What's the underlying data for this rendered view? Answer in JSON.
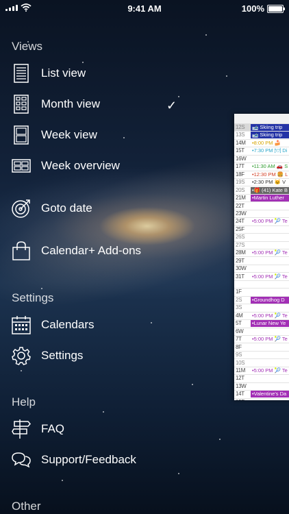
{
  "status_bar": {
    "time": "9:41 AM",
    "battery": "100%"
  },
  "sections": {
    "views": "Views",
    "settings": "Settings",
    "help": "Help",
    "other": "Other"
  },
  "views": {
    "list": "List view",
    "month": "Month view",
    "week": "Week view",
    "week_overview": "Week overview",
    "goto_date": "Goto date",
    "addons": "Calendar+ Add-ons",
    "checkmark": "✓"
  },
  "settings": {
    "calendars": "Calendars",
    "settings": "Settings"
  },
  "help": {
    "faq": "FAQ",
    "support": "Support/Feedback"
  },
  "calendar_preview": {
    "rows": [
      {
        "day": "12S",
        "event": "🎿 Skiing trip",
        "style": "blue"
      },
      {
        "day": "13S",
        "event": "🎿 Skiing trip",
        "style": "blue"
      },
      {
        "day": "14M",
        "event": "•8:00 PM 🍰",
        "style": "t"
      },
      {
        "day": "15T",
        "event": "•7:30 PM 🍽 Di",
        "style": "t"
      },
      {
        "day": "16W",
        "event": "",
        "style": "t"
      },
      {
        "day": "17T",
        "event": "•11:30 AM 🚗 S",
        "style": "t"
      },
      {
        "day": "18F",
        "event": "•12:30 PM 🍔 L",
        "style": "t"
      },
      {
        "day": "19S",
        "event": "•2:30 PM 🐱 V",
        "style": "t"
      },
      {
        "day": "20S",
        "event": "•🎁 (41) Kate B",
        "style": "gray"
      },
      {
        "day": "21M",
        "event": "•Martin Luther",
        "style": "purple"
      },
      {
        "day": "22T",
        "event": "",
        "style": "t"
      },
      {
        "day": "23W",
        "event": "",
        "style": "t"
      },
      {
        "day": "24T",
        "event": "•5:00 PM 🎾 Te",
        "style": "t"
      },
      {
        "day": "25F",
        "event": "",
        "style": "t"
      },
      {
        "day": "26S",
        "event": "",
        "style": "t"
      },
      {
        "day": "27S",
        "event": "",
        "style": "t"
      },
      {
        "day": "28M",
        "event": "•5:00 PM 🎾 Te",
        "style": "t"
      },
      {
        "day": "29T",
        "event": "",
        "style": "t"
      },
      {
        "day": "30W",
        "event": "",
        "style": "t"
      },
      {
        "day": "31T",
        "event": "•5:00 PM 🎾 Te",
        "style": "t"
      },
      {
        "day": "",
        "event": "",
        "style": "t"
      },
      {
        "day": "1F",
        "event": "",
        "style": "t"
      },
      {
        "day": "2S",
        "event": "•Groundhog D",
        "style": "purple"
      },
      {
        "day": "3S",
        "event": "",
        "style": "t"
      },
      {
        "day": "4M",
        "event": "•5:00 PM 🎾 Te",
        "style": "t"
      },
      {
        "day": "5T",
        "event": "•Lunar New Ye",
        "style": "purple"
      },
      {
        "day": "6W",
        "event": "",
        "style": "t"
      },
      {
        "day": "7T",
        "event": "•5:00 PM 🎾 Te",
        "style": "t"
      },
      {
        "day": "8F",
        "event": "",
        "style": "t"
      },
      {
        "day": "9S",
        "event": "",
        "style": "t"
      },
      {
        "day": "10S",
        "event": "",
        "style": "t"
      },
      {
        "day": "11M",
        "event": "•5:00 PM 🎾 Te",
        "style": "t"
      },
      {
        "day": "12T",
        "event": "",
        "style": "t"
      },
      {
        "day": "13W",
        "event": "",
        "style": "t"
      },
      {
        "day": "14T",
        "event": "•Valentine's Da",
        "style": "purple"
      },
      {
        "day": "15F",
        "event": "",
        "style": "t"
      }
    ]
  }
}
